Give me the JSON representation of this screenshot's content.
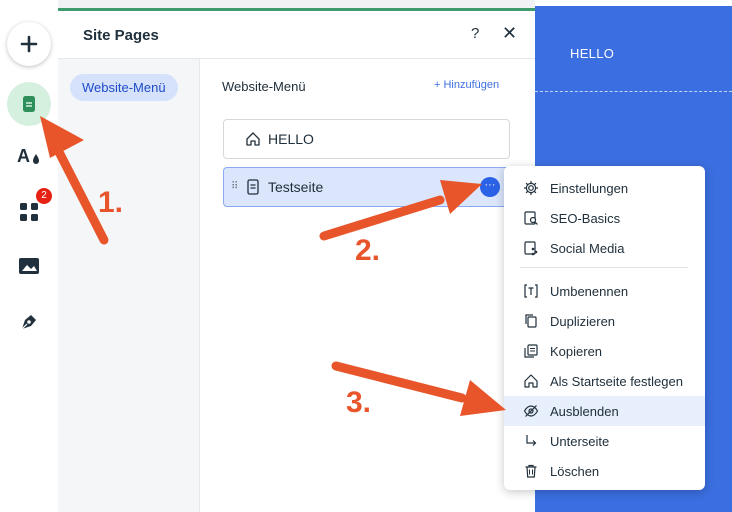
{
  "panel": {
    "title": "Site Pages",
    "help_label": "?",
    "close_label": "✕",
    "menu_tab": "Website-Menü",
    "section_title": "Website-Menü",
    "add_label": "+ Hinzufügen"
  },
  "sidebar": {
    "apps_badge": "2"
  },
  "site": {
    "hello_text": "HELLO"
  },
  "pages": [
    {
      "label": "HELLO",
      "icon": "home-icon"
    },
    {
      "label": "Testseite",
      "icon": "page-icon",
      "selected": true
    }
  ],
  "context_menu": {
    "items": [
      {
        "label": "Einstellungen",
        "icon": "gear-icon"
      },
      {
        "label": "SEO-Basics",
        "icon": "seo-icon"
      },
      {
        "label": "Social Media",
        "icon": "social-icon"
      },
      {
        "label": "Umbenennen",
        "icon": "rename-icon"
      },
      {
        "label": "Duplizieren",
        "icon": "duplicate-icon"
      },
      {
        "label": "Kopieren",
        "icon": "copy-icon"
      },
      {
        "label": "Als Startseite festlegen",
        "icon": "home-icon"
      },
      {
        "label": "Ausblenden",
        "icon": "hide-icon",
        "highlighted": true
      },
      {
        "label": "Unterseite",
        "icon": "subpage-icon"
      },
      {
        "label": "Löschen",
        "icon": "trash-icon"
      }
    ]
  },
  "annotations": {
    "step1": "1.",
    "step2": "2.",
    "step3": "3."
  },
  "colors": {
    "accent": "#3b6ee0",
    "arrow": "#e8552b",
    "pages_green": "#3d9b6d"
  }
}
